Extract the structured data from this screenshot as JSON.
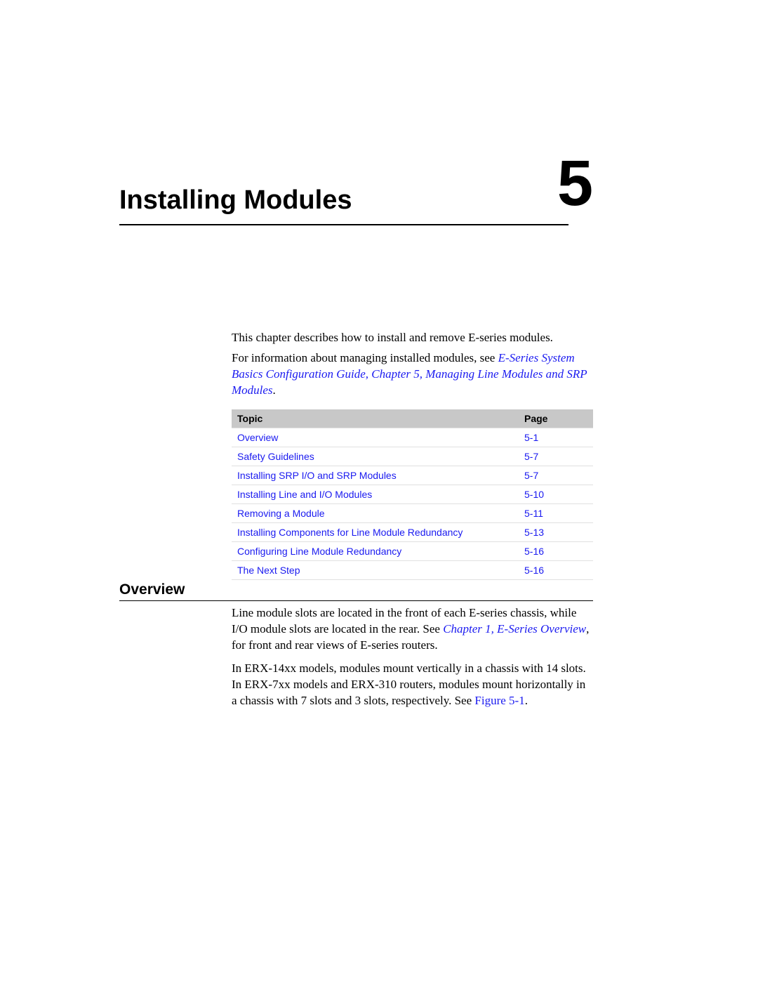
{
  "chapter": {
    "number": "5",
    "title": "Installing Modules"
  },
  "intro": {
    "p1": "This chapter describes how to install and remove E-series modules.",
    "p2_pre": "For information about managing installed modules, see ",
    "p2_link": "E-Series System Basics Configuration Guide, Chapter 5, Managing Line Modules and SRP Modules",
    "p2_post": "."
  },
  "toc": {
    "headers": {
      "topic": "Topic",
      "page": "Page"
    },
    "rows": [
      {
        "topic": "Overview",
        "page": "5-1"
      },
      {
        "topic": "Safety Guidelines",
        "page": "5-7"
      },
      {
        "topic": "Installing SRP I/O and SRP Modules",
        "page": "5-7"
      },
      {
        "topic": "Installing Line and I/O Modules",
        "page": "5-10"
      },
      {
        "topic": "Removing a Module",
        "page": "5-11"
      },
      {
        "topic": "Installing Components for Line Module Redundancy",
        "page": "5-13"
      },
      {
        "topic": "Configuring Line Module Redundancy",
        "page": "5-16"
      },
      {
        "topic": "The Next Step",
        "page": "5-16"
      }
    ]
  },
  "section": {
    "heading": "Overview",
    "p1_pre": "Line module slots are located in the front of each E-series chassis, while I/O module slots are located in the rear. See ",
    "p1_link": "Chapter 1, E-Series Overview",
    "p1_post": ", for front and rear views of E-series routers.",
    "p2_pre": "In ERX-14xx models, modules mount vertically in a chassis with 14 slots. In ERX-7xx models and ERX-310 routers, modules mount horizontally in a chassis with 7 slots and 3 slots, respectively. See ",
    "p2_link": "Figure 5-1",
    "p2_post": "."
  }
}
